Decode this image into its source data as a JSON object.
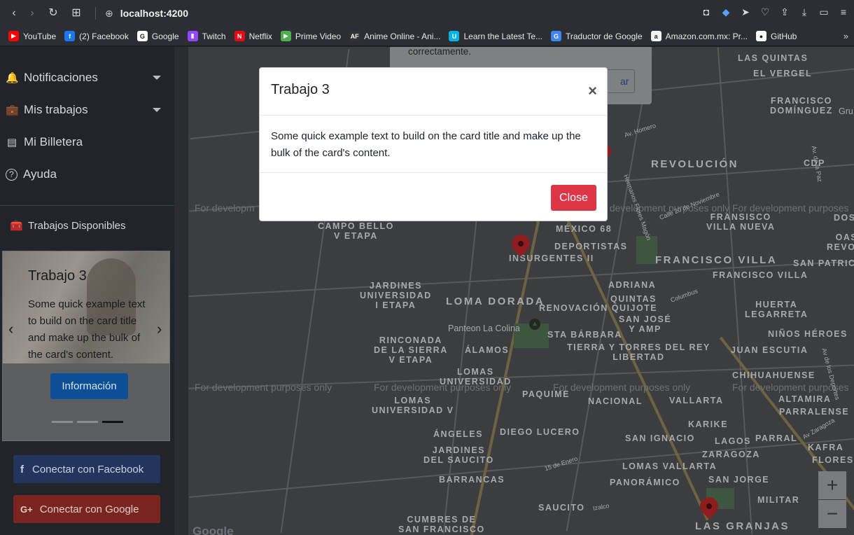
{
  "browser": {
    "url": "localhost:4200",
    "bookmarks": [
      {
        "label": "YouTube",
        "icon": "youtube-icon",
        "color": "#ff0000",
        "glyph": "▶"
      },
      {
        "label": "(2) Facebook",
        "icon": "facebook-icon",
        "color": "#1877f2",
        "glyph": "f"
      },
      {
        "label": "Google",
        "icon": "google-icon",
        "color": "#ffffff",
        "glyph": "G"
      },
      {
        "label": "Twitch",
        "icon": "twitch-icon",
        "color": "#9146ff",
        "glyph": "▮"
      },
      {
        "label": "Netflix",
        "icon": "netflix-icon",
        "color": "#e50914",
        "glyph": "N"
      },
      {
        "label": "Prime Video",
        "icon": "prime-video-icon",
        "color": "#4caf50",
        "glyph": "▶"
      },
      {
        "label": "Anime Online - Ani...",
        "icon": "anime-icon",
        "color": "#333333",
        "glyph": "AF"
      },
      {
        "label": "Learn the Latest Te...",
        "icon": "udacity-icon",
        "color": "#02b3e4",
        "glyph": "U"
      },
      {
        "label": "Traductor de Google",
        "icon": "translate-icon",
        "color": "#4285f4",
        "glyph": "G"
      },
      {
        "label": "Amazon.com.mx: Pr...",
        "icon": "amazon-icon",
        "color": "#f2f2f2",
        "glyph": "a"
      },
      {
        "label": "GitHub",
        "icon": "github-icon",
        "color": "#ffffff",
        "glyph": "●"
      }
    ],
    "more": "»"
  },
  "sidebar": {
    "items": [
      {
        "label": "Notificaciones",
        "icon": "bell-icon",
        "glyph": "🔔"
      },
      {
        "label": "Mis trabajos",
        "icon": "briefcase-icon",
        "glyph": "💼"
      },
      {
        "label": "Mi Billetera",
        "icon": "credit-card-icon",
        "glyph": "▤"
      },
      {
        "label": "Ayuda",
        "icon": "help-circle-icon",
        "glyph": "?"
      }
    ],
    "available_label": "Trabajos Disponibles",
    "carousel": {
      "title": "Trabajo 3",
      "text": "Some quick example text to build on the card title and make up the bulk of the card's content.",
      "button": "Información",
      "prev": "‹",
      "next": "›",
      "active_index": 2,
      "count": 3
    },
    "facebook_button": "Conectar con Facebook",
    "google_button": "Conectar con Google"
  },
  "map": {
    "toast_text": "correctamente.",
    "toast_button": "ar",
    "dev_text": "For development purposes only",
    "dev_text_cut": "For development purposes",
    "dev_text_cut_short": "For developm",
    "labels": {
      "las_quintas": "LAS QUINTAS",
      "el_vergel": "EL VERGEL",
      "francisco_dominguez": "FRANCISCO\nDOMÍNGUEZ",
      "revolucion": "REVOLUCIÓN",
      "cdp": "CDP",
      "campo_bello": "CAMPO BELLO\nV ETAPA",
      "mexico_68": "MÉXICO 68",
      "deportistas": "DEPORTISTAS",
      "insurgentes": "INSURGENTES II",
      "francisco_villa_nueva": "FRANSISCO\nVILLA NUEVA",
      "francisco_villa": "FRANCISCO VILLA",
      "francisco_villa_2": "FRANCISCO VILLA",
      "san_patricio": "SAN PATRICIO",
      "oasis": "OASIS\nREVOLUC",
      "dos_de": "DOS DE",
      "jardines_universidad": "JARDINES\nUNIVERSIDAD\nI ETAPA",
      "loma_dorada": "LOMA DORADA",
      "adriana": "ADRIANA",
      "renovacion": "RENOVACIÓN QUIJOTE",
      "quintas": "QUINTAS",
      "san_jose": "SAN JOSÉ\nY AMP",
      "huerta": "HUERTA\nLEGARRETA",
      "panteon": "Panteon La Colina",
      "santa_barbara": "STA BÁRBARA",
      "ninos_heroes": "NIÑOS HÉROES",
      "rinconada": "RINCONADA\nDE LA SIERRA\nV ETAPA",
      "alamos": "ÁLAMOS",
      "tierra_torres": "TIERRA Y TORRES DEL REY\nLIBERTAD",
      "juan_escutia": "JUAN ESCUTIA",
      "lomas_universidad": "LOMAS\nUNIVERSIDAD",
      "chihuahuense": "CHIHUAHUENSE",
      "paquime": "PAQUIME",
      "nacional": "NACIONAL",
      "vallarta": "VALLARTA",
      "altamira": "ALTAMIRA",
      "parralense": "PARRALENSE",
      "lomas_universidad_v": "LOMAS\nUNIVERSIDAD V",
      "karike": "KARIKE",
      "angeles": "ÁNGELES",
      "diego_lucero": "DIEGO LUCERO",
      "san_ignacio": "SAN IGNACIO",
      "lagos": "LAGOS",
      "parral": "PARRAL",
      "kafra": "KAFRA",
      "jardines_saucito": "JARDINES\nDEL SAUCITO",
      "zaragoza": "ZARAGOZA",
      "floresta": "FLORESTA",
      "lomas_vallarta": "LOMAS VALLARTA",
      "barrancas": "BARRANCAS",
      "panoramico": "PANORÁMICO",
      "san_jorge": "SAN JORGE",
      "militar": "MILITAR",
      "saucito": "SAUCITO",
      "cumbres": "CUMBRES DE\nSAN FRANCISCO",
      "las_granjas": "LAS GRANJAS",
      "columbus": "Columbus",
      "av_homero": "Av. Homero",
      "izalco": "Izalco",
      "quince_enero": "15 de Enero",
      "av_zaragoza": "Av Zaragoza",
      "calle_noviembre": "Calle 20 de Noviembre",
      "hermanos_magon": "Hermanos Flores Magón",
      "av_de_la_paz": "Av. de la Paz",
      "ave_dos": "Av de los Deportes",
      "gru": "Gru",
      "logo": "Google"
    },
    "zoom_in": "+",
    "zoom_out": "−"
  },
  "modal": {
    "title": "Trabajo 3",
    "close_x": "×",
    "body": "Some quick example text to build on the card title and make up the bulk of the card's content.",
    "close_button": "Close"
  },
  "colors": {
    "danger": "#dc3545",
    "primary": "#0d6efd",
    "facebook": "#3b5998",
    "google": "#dd4b39",
    "sidebar_bg": "#212529"
  }
}
